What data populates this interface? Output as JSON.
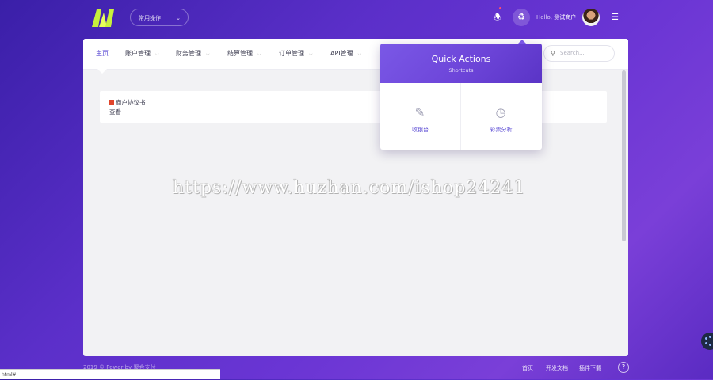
{
  "topbar": {
    "quick_menu_label": "常用操作",
    "hello_prefix": "Hello,",
    "user_name": "测试商户"
  },
  "nav": {
    "items": [
      {
        "label": "主页"
      },
      {
        "label": "账户管理"
      },
      {
        "label": "财务管理"
      },
      {
        "label": "结算管理"
      },
      {
        "label": "订单管理"
      },
      {
        "label": "API管理"
      }
    ],
    "search_placeholder": "Search..."
  },
  "notice": {
    "title": "商户协议书",
    "link": "查看"
  },
  "watermark": "https://www.huzhan.com/ishop24241",
  "quick_actions": {
    "title": "Quick Actions",
    "subtitle": "Shortcuts",
    "items": [
      {
        "label": "收银台",
        "icon": "cashier-icon"
      },
      {
        "label": "彩票分析",
        "icon": "lottery-icon"
      }
    ]
  },
  "footer": {
    "copyright": "2019 © Power by 聚合支付",
    "links": [
      "首页",
      "开发文档",
      "插件下载"
    ]
  },
  "statusbar": {
    "url": "html#"
  },
  "colors": {
    "accent": "#5b4bd4",
    "header_gradient_start": "#7a58e6",
    "background": "#5b2fc9"
  }
}
